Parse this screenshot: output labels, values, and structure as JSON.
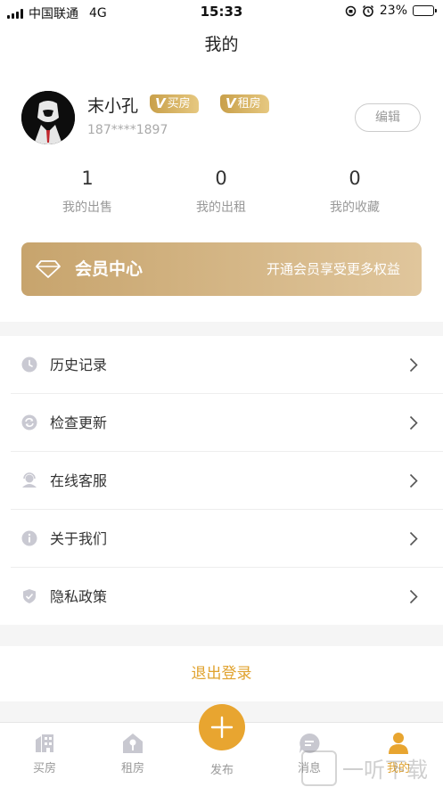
{
  "status_bar": {
    "carrier": "中国联通",
    "network": "4G",
    "time": "15:33",
    "battery": "23%",
    "battery_level": 0.23
  },
  "nav": {
    "title": "我的"
  },
  "profile": {
    "name": "末小孔",
    "tags": [
      {
        "letter": "V",
        "text": "买房"
      },
      {
        "letter": "V",
        "text": "租房"
      }
    ],
    "phone": "187****1897",
    "edit_label": "编辑"
  },
  "stats": [
    {
      "value": "1",
      "label": "我的出售"
    },
    {
      "value": "0",
      "label": "我的出租"
    },
    {
      "value": "0",
      "label": "我的收藏"
    }
  ],
  "member": {
    "title": "会员中心",
    "subtitle": "开通会员享受更多权益",
    "icon": "diamond-icon"
  },
  "menu": [
    {
      "label": "历史记录",
      "icon": "clock-icon"
    },
    {
      "label": "检查更新",
      "icon": "refresh-icon"
    },
    {
      "label": "在线客服",
      "icon": "support-agent-icon"
    },
    {
      "label": "关于我们",
      "icon": "info-icon"
    },
    {
      "label": "隐私政策",
      "icon": "shield-icon"
    }
  ],
  "logout_label": "退出登录",
  "tabs": [
    {
      "label": "买房",
      "icon": "building-icon"
    },
    {
      "label": "租房",
      "icon": "house-key-icon"
    },
    {
      "label": "发布",
      "icon": "plus-icon"
    },
    {
      "label": "消息",
      "icon": "message-icon"
    },
    {
      "label": "我的",
      "icon": "person-icon"
    }
  ],
  "colors": {
    "accent": "#e8a530",
    "member_gradient_start": "#c7a46d",
    "member_gradient_end": "#e0c69c",
    "menu_icon": "#c9c9d2"
  },
  "watermark": "一听下载"
}
